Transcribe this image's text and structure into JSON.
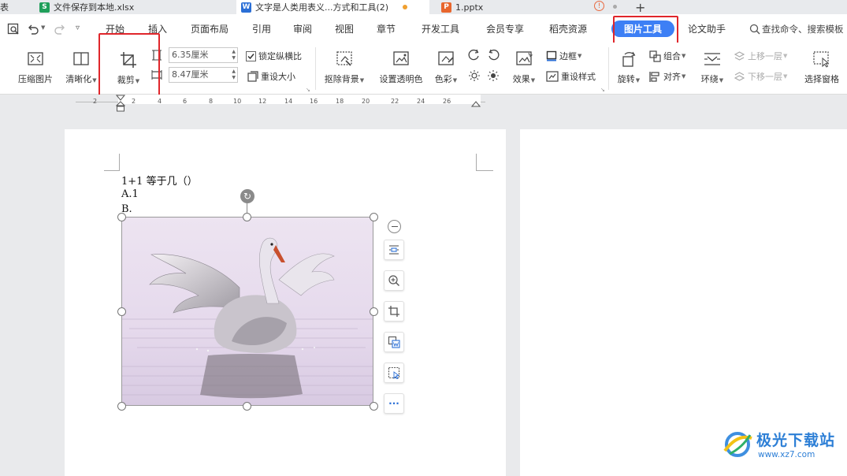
{
  "tabs": [
    {
      "label": "表",
      "icon": "none"
    },
    {
      "label": "文件保存到本地.xlsx",
      "icon": "S"
    },
    {
      "label": "文字是人类用表义...方式和工具(2)",
      "icon": "W"
    },
    {
      "label": "1.pptx",
      "icon": "P"
    }
  ],
  "new_tab_label": "+",
  "menu": {
    "items": [
      "开始",
      "插入",
      "页面布局",
      "引用",
      "审阅",
      "视图",
      "章节",
      "开发工具",
      "会员专享",
      "稻壳资源"
    ],
    "active": "图片工具",
    "after_active": "论文助手",
    "search_placeholder": "查找命令、搜索模板"
  },
  "ribbon": {
    "compress": "压缩图片",
    "clarify": "清晰化",
    "crop": "裁剪",
    "height_value": "6.35厘米",
    "width_value": "8.47厘米",
    "lock_ratio": "锁定纵横比",
    "reset_size": "重设大小",
    "remove_bg": "抠除背景",
    "set_transparent": "设置透明色",
    "color": "色彩",
    "effects": "效果",
    "border": "边框",
    "reset_style": "重设样式",
    "rotate": "旋转",
    "group": "组合",
    "align": "对齐",
    "wrap": "环绕",
    "bring_forward": "上移一层",
    "send_backward": "下移一层",
    "selection_pane": "选择窗格"
  },
  "ruler_ticks": [
    "2",
    "2",
    "4",
    "6",
    "8",
    "10",
    "12",
    "14",
    "16",
    "18",
    "20",
    "22",
    "24",
    "26"
  ],
  "document": {
    "lines": [
      "1+1 等于几（）",
      "A.1",
      "B."
    ]
  },
  "watermark": {
    "name": "极光下载站",
    "url": "www.xz7.com"
  },
  "colors": {
    "accent": "#3d7ff5",
    "highlight_box": "#e0262b",
    "sheet_icon": "#1f9f5a",
    "word_icon": "#2b6fd6",
    "ppt_icon": "#e8662d"
  }
}
